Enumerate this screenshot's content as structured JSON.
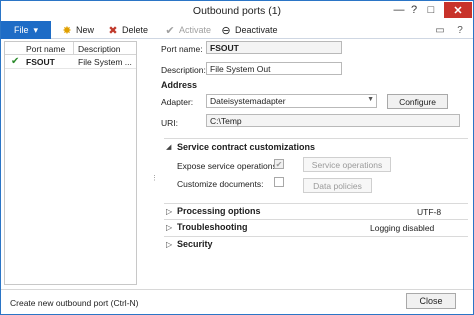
{
  "window": {
    "title": "Outbound ports (1)",
    "controls": {
      "minimize": "—",
      "help": "?",
      "maximize": "□",
      "close": "✕"
    }
  },
  "toolbar": {
    "file_label": "File",
    "file_arrow": "▾",
    "new_label": "New",
    "delete_label": "Delete",
    "activate_label": "Activate",
    "deactivate_label": "Deactivate",
    "icons": {
      "new": "✸",
      "delete": "✖",
      "activate": "✔",
      "deactivate": "⊖",
      "layout": "▭",
      "help": "?"
    }
  },
  "grid": {
    "headers": [
      "Port name",
      "Description"
    ],
    "rows": [
      {
        "check": "✔",
        "port": "FSOUT",
        "description": "File System ..."
      }
    ]
  },
  "form": {
    "port_name_label": "Port name:",
    "port_name_value": "FSOUT",
    "description_label": "Description:",
    "description_value": "File System Out",
    "address_header": "Address",
    "adapter_label": "Adapter:",
    "adapter_value": "Dateisystemadapter",
    "dd_arrow": "▼",
    "configure_label": "Configure",
    "uri_label": "URI:",
    "uri_value": "C:\\Temp"
  },
  "service_contract": {
    "title": "Service contract customizations",
    "arrow": "◢",
    "expose_label": "Expose service operations:",
    "expose_check": "✔",
    "service_operations_label": "Service operations",
    "customize_label": "Customize documents:",
    "data_policies_label": "Data policies"
  },
  "fasttabs": [
    {
      "title": "Processing options",
      "arrow": "▷",
      "summary": "UTF-8"
    },
    {
      "title": "Troubleshooting",
      "arrow": "▷",
      "summary": "Logging disabled"
    },
    {
      "title": "Security",
      "arrow": "▷",
      "summary": ""
    }
  ],
  "splitter": "⋮",
  "status": {
    "text": "Create new outbound port (Ctrl-N)",
    "close_label": "Close"
  }
}
